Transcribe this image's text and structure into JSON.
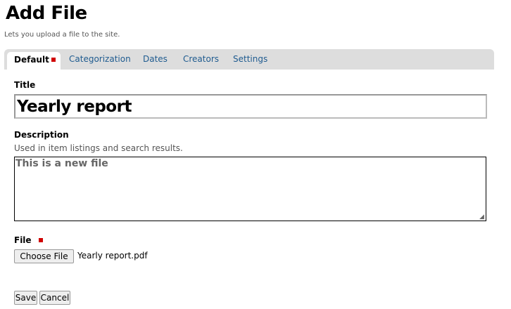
{
  "header": {
    "title": "Add File",
    "subtitle": "Lets you upload a file to the site."
  },
  "tabs": [
    {
      "label": "Default",
      "active": true,
      "required": true
    },
    {
      "label": "Categorization"
    },
    {
      "label": "Dates"
    },
    {
      "label": "Creators"
    },
    {
      "label": "Settings"
    }
  ],
  "form": {
    "title": {
      "label": "Title",
      "value": "Yearly report"
    },
    "description": {
      "label": "Description",
      "help": "Used in item listings and search results.",
      "value": "This is a new file"
    },
    "file": {
      "label": "File",
      "required": true,
      "button_label": "Choose File",
      "selected_file": "Yearly report.pdf"
    }
  },
  "actions": {
    "save_label": "Save",
    "cancel_label": "Cancel"
  },
  "colors": {
    "required_marker": "#d00000",
    "tab_link": "#205c90",
    "tab_bar": "#dddddd"
  }
}
